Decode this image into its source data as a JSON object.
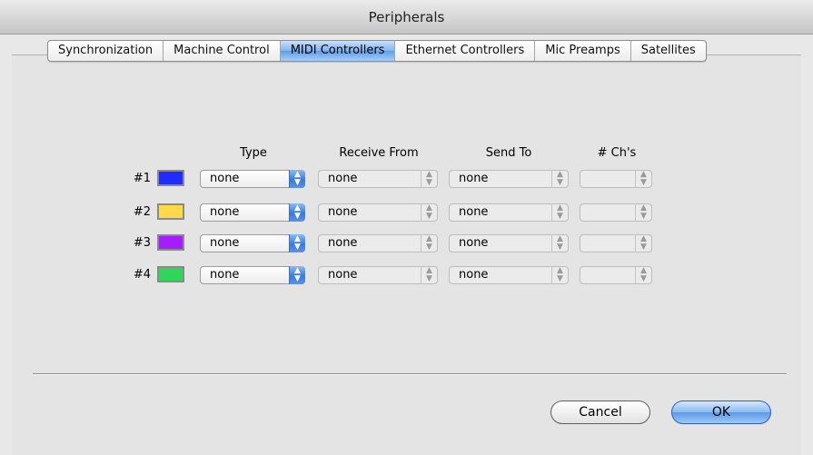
{
  "window": {
    "title": "Peripherals"
  },
  "tabs": [
    {
      "label": "Synchronization",
      "active": false
    },
    {
      "label": "Machine Control",
      "active": false
    },
    {
      "label": "MIDI Controllers",
      "active": true
    },
    {
      "label": "Ethernet Controllers",
      "active": false
    },
    {
      "label": "Mic Preamps",
      "active": false
    },
    {
      "label": "Satellites",
      "active": false
    }
  ],
  "table": {
    "headers": {
      "type": "Type",
      "receive_from": "Receive From",
      "send_to": "Send To",
      "channels": "# Ch's"
    },
    "rows": [
      {
        "number": "#1",
        "color": "#1f2cff",
        "type": "none",
        "receive_from": "none",
        "send_to": "none",
        "channels": ""
      },
      {
        "number": "#2",
        "color": "#ffd94a",
        "type": "none",
        "receive_from": "none",
        "send_to": "none",
        "channels": ""
      },
      {
        "number": "#3",
        "color": "#a41cff",
        "type": "none",
        "receive_from": "none",
        "send_to": "none",
        "channels": ""
      },
      {
        "number": "#4",
        "color": "#2ed65a",
        "type": "none",
        "receive_from": "none",
        "send_to": "none",
        "channels": ""
      }
    ]
  },
  "buttons": {
    "cancel": "Cancel",
    "ok": "OK"
  },
  "icons": {
    "popup_active_arrows": "up-down-arrows-icon",
    "popup_disabled_arrows": "up-down-arrows-icon"
  },
  "colors": {
    "accent": "#5f9ee8"
  }
}
